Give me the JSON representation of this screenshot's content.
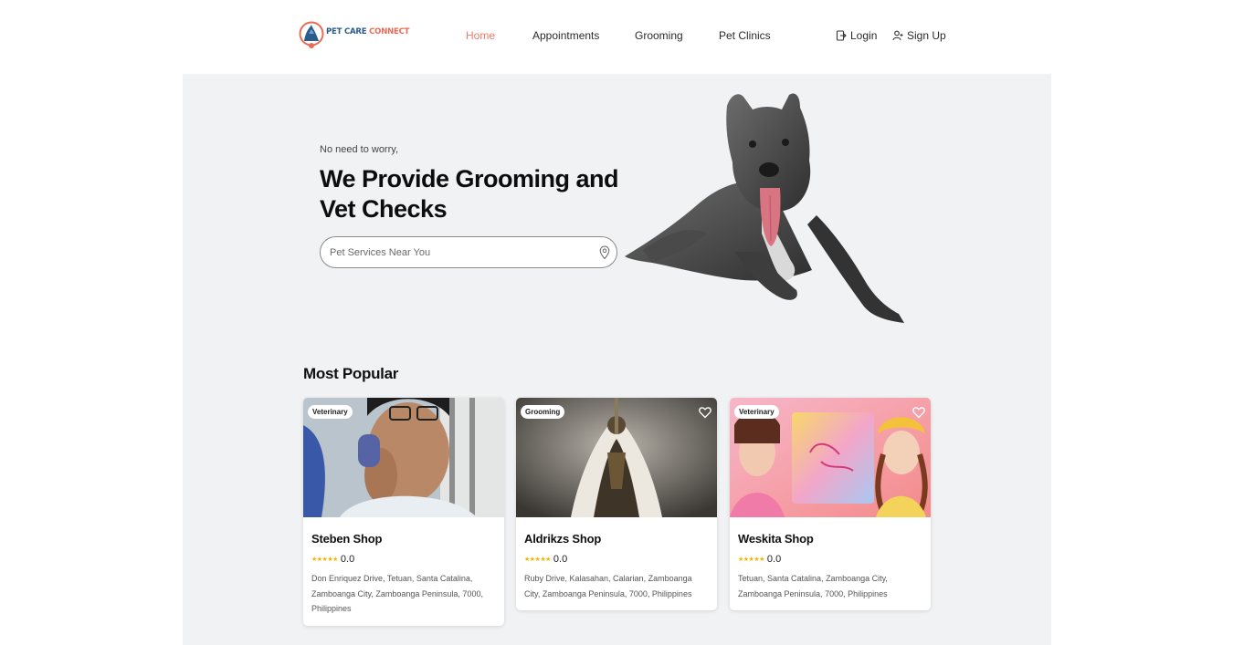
{
  "brand": {
    "part1": "PET CARE",
    "part2": "CONNECT"
  },
  "nav": {
    "items": [
      {
        "label": "Home",
        "active": true
      },
      {
        "label": "Appointments",
        "active": false
      },
      {
        "label": "Grooming",
        "active": false
      },
      {
        "label": "Pet Clinics",
        "active": false
      }
    ],
    "login_label": "Login",
    "signup_label": "Sign Up"
  },
  "hero": {
    "eyebrow": "No need to worry,",
    "title": "We Provide Grooming and Vet Checks",
    "search_placeholder": "Pet Services Near You"
  },
  "popular": {
    "title": "Most Popular",
    "cards": [
      {
        "category": "Veterinary",
        "name": "Steben Shop",
        "stars": "★★★★★",
        "rating": "0.0",
        "address": "Don Enriquez Drive, Tetuan, Santa Catalina, Zamboanga City, Zamboanga Peninsula, 7000, Philippines"
      },
      {
        "category": "Grooming",
        "name": "Aldrikzs Shop",
        "stars": "★★★★★",
        "rating": "0.0",
        "address": "Ruby Drive, Kalasahan, Calarian, Zamboanga City, Zamboanga Peninsula, 7000, Philippines"
      },
      {
        "category": "Veterinary",
        "name": "Weskita Shop",
        "stars": "★★★★★",
        "rating": "0.0",
        "address": "Tetuan, Santa Catalina, Zamboanga City, Zamboanga Peninsula, 7000, Philippines"
      }
    ]
  },
  "colors": {
    "accent": "#ef7a66",
    "brand_blue": "#2b5a8c",
    "star": "#f2b400",
    "panel_bg": "#f1f2f3"
  },
  "icons": {
    "login": "login-icon",
    "signup": "add-user-icon",
    "search": "map-pin-icon",
    "favorite": "heart-icon"
  }
}
